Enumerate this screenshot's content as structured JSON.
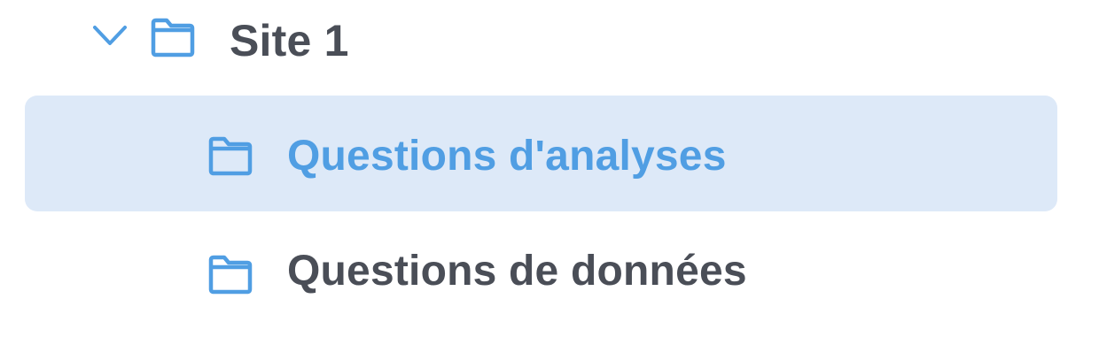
{
  "tree": {
    "parent": {
      "label": "Site 1",
      "expanded": true,
      "expand_icon": "chevron-down-icon",
      "icon": "folder-icon"
    },
    "children": [
      {
        "label": "Questions d'analyses",
        "icon": "folder-icon",
        "selected": true
      },
      {
        "label": "Questions de données",
        "icon": "folder-icon",
        "selected": false
      }
    ]
  },
  "colors": {
    "accent": "#509ee3",
    "selected_background": "#dde9f8",
    "text": "#4a4e57"
  }
}
